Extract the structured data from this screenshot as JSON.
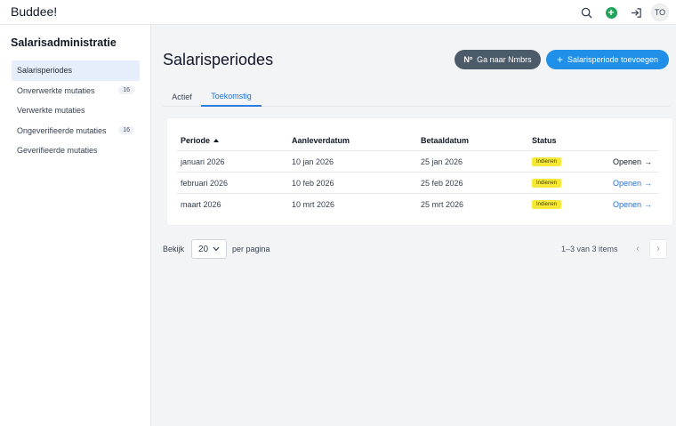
{
  "header": {
    "brand": "Buddee!",
    "avatar_initials": "TO",
    "icons": [
      "search-icon",
      "add-circle-icon",
      "logout-icon"
    ],
    "accent_green": "#22a35a"
  },
  "sidebar": {
    "title": "Salarisadministratie",
    "items": [
      {
        "label": "Salarisperiodes",
        "count": "",
        "active": true
      },
      {
        "label": "Onverwerkte mutaties",
        "count": "16"
      },
      {
        "label": "Verwerkte mutaties",
        "count": ""
      },
      {
        "label": "Ongeverifieerde mutaties",
        "count": "16"
      },
      {
        "label": "Geverifieerde mutaties",
        "count": ""
      }
    ]
  },
  "main": {
    "title": "Salarisperiodes",
    "buttons": {
      "nmbrs_mark": "Nº",
      "nmbrs_label": "Ga naar Nmbrs",
      "add_plus": "+",
      "add_label": "Salarisperiode toevoegen",
      "primary_color": "#1f8fe8",
      "secondary_color": "#4b5b6a"
    },
    "tabs": [
      {
        "label": "Actief",
        "active": false
      },
      {
        "label": "Toekomstig",
        "active": true
      }
    ],
    "table": {
      "columns": [
        "Periode",
        "Aanleverdatum",
        "Betaaldatum",
        "Status"
      ],
      "rows": [
        {
          "periode": "januari 2026",
          "aanlever": "10 jan 2026",
          "betaal": "25 jan 2026",
          "status": "Indienen",
          "action": "Openen",
          "arrow": "→"
        },
        {
          "periode": "februari 2026",
          "aanlever": "10 feb 2026",
          "betaal": "25 feb 2026",
          "status": "Indienen",
          "action": "Openen",
          "arrow": "→"
        },
        {
          "periode": "maart 2026",
          "aanlever": "10 mrt 2026",
          "betaal": "25 mrt 2026",
          "status": "Indienen",
          "action": "Openen",
          "arrow": "→"
        }
      ],
      "status_color": "#f7e93a"
    },
    "pagination": {
      "prefix": "Bekijk",
      "per_page": "20",
      "suffix": "per pagina",
      "range": "1–3 van 3 items",
      "prev": "‹",
      "next": "›"
    }
  }
}
